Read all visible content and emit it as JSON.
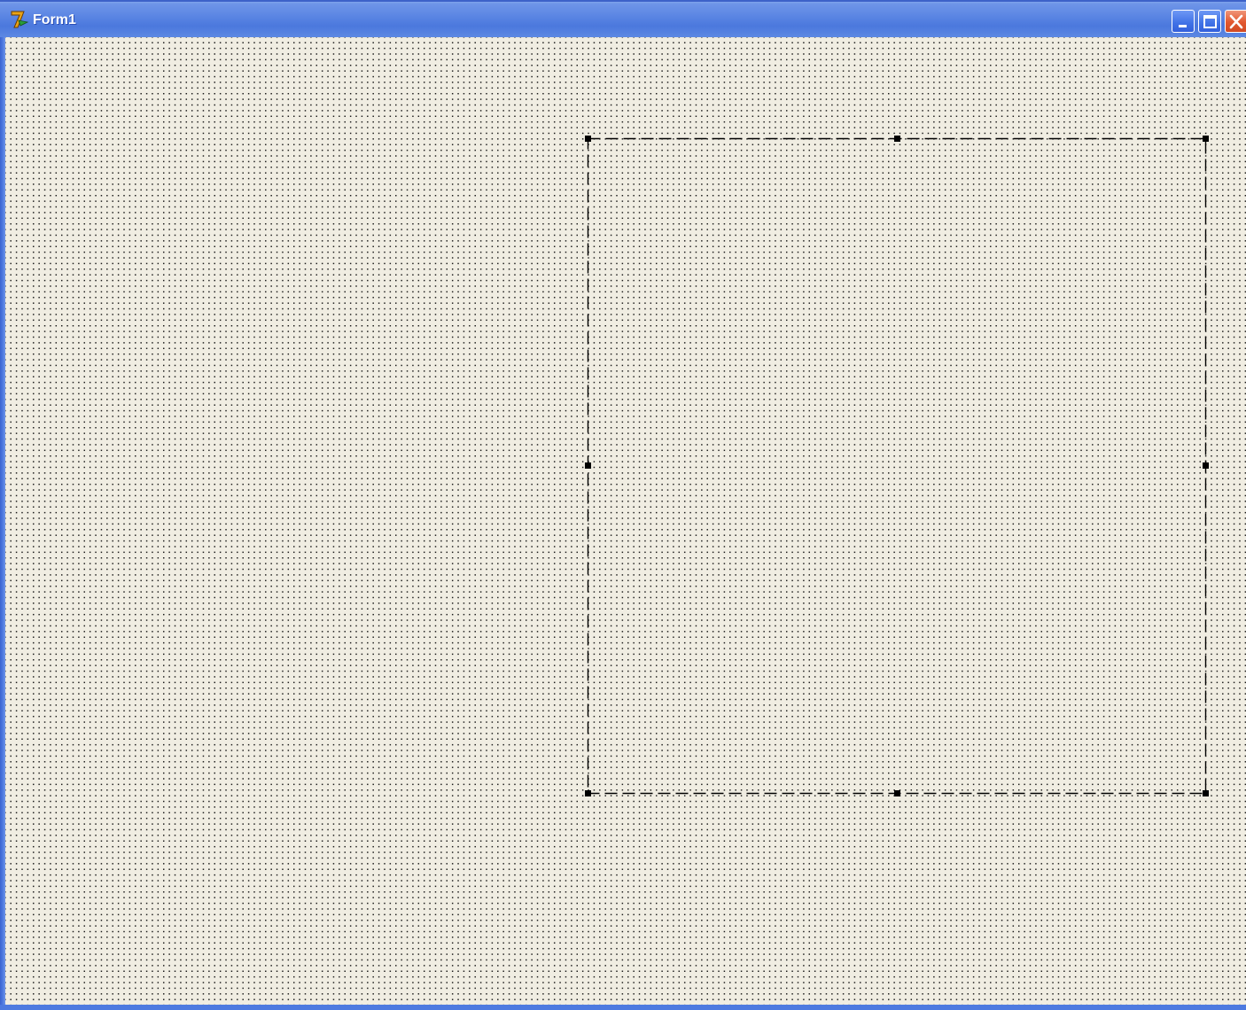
{
  "window": {
    "title": "Form1",
    "icons": {
      "app": "delphi-app-icon",
      "minimize": "minimize-icon",
      "maximize": "maximize-icon",
      "close": "close-icon"
    },
    "colors": {
      "titlebar": "#4b78dd",
      "client_background": "#f0ede2",
      "close_button": "#e2582f",
      "grid_dot": "#1a1a1a",
      "selection_outline": "#000000"
    }
  },
  "designer": {
    "grid_visible": true,
    "selection_visible": true,
    "selection_handles": 8
  }
}
